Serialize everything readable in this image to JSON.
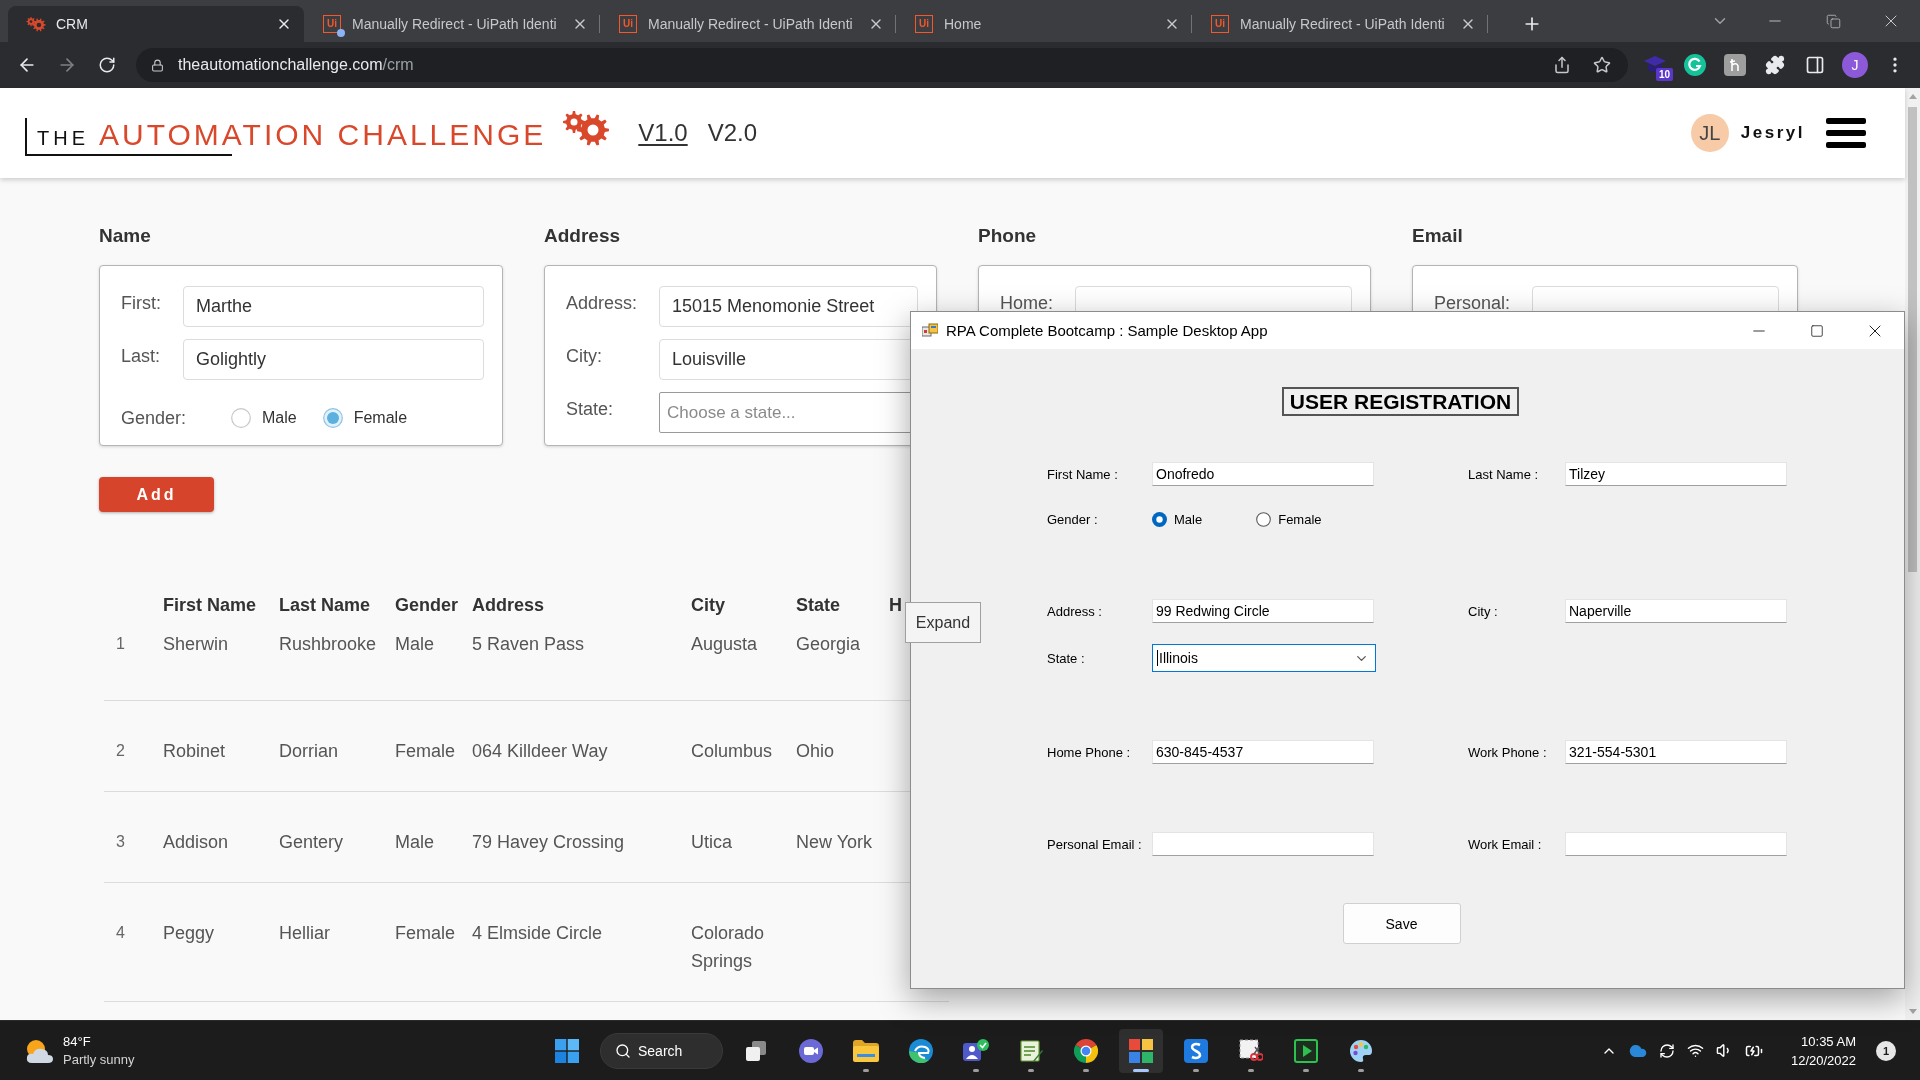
{
  "browser": {
    "tabs": [
      {
        "kind": "gear",
        "title": "CRM",
        "selected": true,
        "alert": false
      },
      {
        "kind": "ui",
        "icon_text": "Ui",
        "title": "Manually Redirect - UiPath Identi",
        "selected": false,
        "alert": true
      },
      {
        "kind": "ui",
        "icon_text": "Ui",
        "title": "Manually Redirect - UiPath Identi",
        "selected": false,
        "alert": false
      },
      {
        "kind": "ui",
        "icon_text": "Ui",
        "title": "Home",
        "selected": false,
        "alert": false
      },
      {
        "kind": "ui",
        "icon_text": "Ui",
        "title": "Manually Redirect - UiPath Identi",
        "selected": false,
        "alert": false
      }
    ],
    "url": {
      "host": "theautomationchallenge.com",
      "path": "/crm"
    },
    "extension_badge": "10",
    "profile_initial": "J"
  },
  "header": {
    "logo": {
      "prefix": "THE",
      "title": "AUTOMATION CHALLENGE"
    },
    "versions": [
      {
        "label": "V1.0",
        "selected": true
      },
      {
        "label": "V2.0",
        "selected": false
      }
    ],
    "user": {
      "initials": "JL",
      "name": "Jesryl"
    }
  },
  "cards": [
    {
      "title": "Name",
      "fields": [
        {
          "kind": "text",
          "label": "First:",
          "value": "Marthe"
        },
        {
          "kind": "text",
          "label": "Last:",
          "value": "Golightly"
        },
        {
          "kind": "radio",
          "label": "Gender:",
          "options": [
            {
              "label": "Male",
              "selected": false
            },
            {
              "label": "Female",
              "selected": true
            }
          ]
        }
      ]
    },
    {
      "title": "Address",
      "fields": [
        {
          "kind": "text",
          "label": "Address:",
          "value": "15015 Menomonie Street"
        },
        {
          "kind": "text",
          "label": "City:",
          "value": "Louisville"
        },
        {
          "kind": "select",
          "label": "State:",
          "placeholder": "Choose a state..."
        }
      ]
    },
    {
      "title": "Phone",
      "fields": [
        {
          "kind": "text",
          "label": "Home:"
        }
      ]
    },
    {
      "title": "Email",
      "fields": [
        {
          "kind": "text",
          "label": "Personal:"
        }
      ]
    }
  ],
  "add_button": "Add",
  "table": {
    "columns": [
      "First Name",
      "Last Name",
      "Gender",
      "Address",
      "City",
      "State",
      "H"
    ],
    "rows": [
      {
        "index": "1",
        "cells": [
          "Sherwin",
          "Rushbrooke",
          "Male",
          "5 Raven Pass",
          "Augusta",
          "Georgia"
        ]
      },
      {
        "index": "2",
        "cells": [
          "Robinet",
          "Dorrian",
          "Female",
          "064 Killdeer Way",
          "Columbus",
          "Ohio"
        ]
      },
      {
        "index": "3",
        "cells": [
          "Addison",
          "Gentery",
          "Male",
          "79 Havey Crossing",
          "Utica",
          "New York"
        ]
      },
      {
        "index": "4",
        "cells": [
          "Peggy",
          "Helliar",
          "Female",
          "4 Elmside Circle",
          "Colorado Springs"
        ]
      }
    ]
  },
  "expand_button": "Expand",
  "desktop_app": {
    "title": "RPA Complete Bootcamp : Sample Desktop App",
    "heading": "USER REGISTRATION",
    "groups": [
      {
        "rows": [
          {
            "fields": [
              {
                "kind": "text",
                "label": "First Name :",
                "value": "Onofredo",
                "focused": false
              },
              {
                "kind": "text",
                "label": "Last Name :",
                "value": "Tilzey",
                "focused": false
              }
            ]
          },
          {
            "fields": [
              {
                "kind": "radio",
                "label": "Gender :",
                "options": [
                  {
                    "label": "Male",
                    "selected": true
                  },
                  {
                    "label": "Female",
                    "selected": false
                  }
                ]
              }
            ]
          }
        ]
      },
      {
        "rows": [
          {
            "fields": [
              {
                "kind": "text",
                "label": "Address :",
                "value": "99 Redwing Circle",
                "focused": false
              },
              {
                "kind": "text",
                "label": "City :",
                "value": "Naperville",
                "focused": false
              }
            ]
          },
          {
            "fields": [
              {
                "kind": "combo",
                "label": "State :",
                "value": "Illinois",
                "focused": true
              }
            ]
          }
        ]
      },
      {
        "rows": [
          {
            "fields": [
              {
                "kind": "text",
                "label": "Home Phone :",
                "value": "630-845-4537",
                "focused": false
              },
              {
                "kind": "text",
                "label": "Work Phone :",
                "value": "321-554-5301",
                "focused": false
              }
            ]
          }
        ]
      },
      {
        "rows": [
          {
            "fields": [
              {
                "kind": "text",
                "label": "Personal Email :",
                "focused": false
              },
              {
                "kind": "text",
                "label": "Work Email :",
                "focused": false
              }
            ]
          }
        ]
      }
    ],
    "save_button": "Save"
  },
  "taskbar": {
    "weather": {
      "temperature": "84°F",
      "condition": "Partly sunny"
    },
    "search": "Search",
    "apps": [
      {
        "kind": "task-view",
        "running": false,
        "selected": false
      },
      {
        "kind": "video-chat",
        "running": false,
        "selected": false
      },
      {
        "kind": "folder",
        "running": true,
        "selected": false
      },
      {
        "kind": "swirl",
        "running": false,
        "selected": false
      },
      {
        "kind": "people",
        "running": true,
        "selected": false
      },
      {
        "kind": "notepad",
        "running": true,
        "selected": false
      },
      {
        "kind": "browser",
        "running": true,
        "selected": false
      },
      {
        "kind": "tiles",
        "running": true,
        "selected": true
      },
      {
        "kind": "s-tile",
        "running": true,
        "selected": false
      },
      {
        "kind": "snip",
        "running": true,
        "selected": false
      },
      {
        "kind": "play",
        "running": true,
        "selected": false
      },
      {
        "kind": "palette",
        "running": true,
        "selected": false
      }
    ],
    "clock": {
      "time": "10:35 AM",
      "date": "12/20/2022"
    },
    "notifications": "1"
  }
}
